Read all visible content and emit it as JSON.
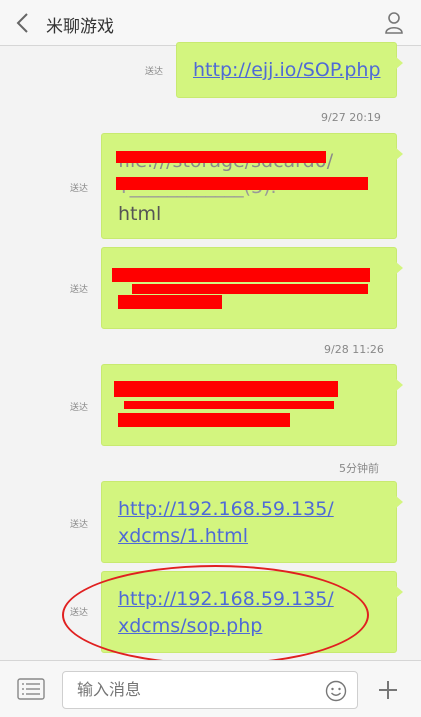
{
  "header": {
    "title": "米聊游戏",
    "back_icon": "chevron-left-icon",
    "profile_icon": "person-icon"
  },
  "messages": [
    {
      "status": "送达",
      "text": "http://ejj.io/SOP.php"
    },
    {
      "timestamp": "9/27 20:19"
    },
    {
      "status": "送达",
      "lines": [
        "file:///storage/sdcard0/",
        "html"
      ]
    },
    {
      "status": "送达"
    },
    {
      "timestamp": "9/28 11:26"
    },
    {
      "status": "送达"
    },
    {
      "timestamp": "5分钟前"
    },
    {
      "status": "送达",
      "lines": [
        "http://192.168.59.135/",
        "xdcms/1.html"
      ]
    },
    {
      "status": "送达",
      "lines": [
        "http://192.168.59.135/",
        "xdcms/sop.php"
      ]
    }
  ],
  "composer": {
    "placeholder": "输入消息",
    "menu_icon": "list-icon",
    "emoji_icon": "smiley-icon",
    "add_icon": "plus-icon"
  },
  "colors": {
    "bubble": "#d3f57f",
    "link": "#4f6ad6",
    "redaction": "#ff0000",
    "highlight_oval": "#e02020"
  }
}
